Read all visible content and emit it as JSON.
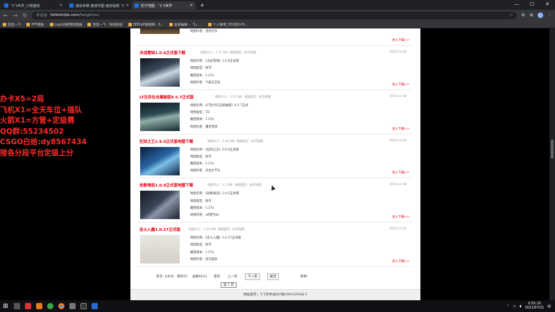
{
  "browser": {
    "tabs": [
      {
        "label": "飞飞世界_只做魔兽",
        "active": false
      },
      {
        "label": "魔兽争霸 魔兽地图 魔兽秘籍 飞",
        "active": false
      },
      {
        "label": "防守地图 - 飞飞世界",
        "active": true
      }
    ],
    "newtab": "+",
    "window_controls": [
      "—",
      "☐",
      "✕"
    ],
    "nav": {
      "back": "←",
      "forward": "→",
      "reload": "↻"
    },
    "address": {
      "security": "不安全",
      "host": "feifeishijie.com",
      "path": "/fangshou/"
    },
    "bookmarks": [
      "百度一下",
      "PPT模板",
      "csgo比赛预测直播",
      "百度一下，你就知道",
      "SEPLAY模组网 - S...",
      "吾爱破解 - 「L」...",
      "个人微博_SEO提升平..."
    ]
  },
  "overlay": {
    "lines": [
      "办卡X5=2局",
      "飞机X1=全天车位+插队",
      "火箭X1=方管+定级赛",
      "QQ群:55234502",
      "CSGO白给:dy8567434",
      "接各分段平台定级上分"
    ]
  },
  "listing": {
    "labels": {
      "name": "地图名称：",
      "type": "地图类型：",
      "env": "魔兽版本：",
      "author": "地图作者：",
      "size_prefix": "地图大小：",
      "type_prefix": "地图类型：",
      "more": "进入下载>>"
    },
    "first_partial": {
      "author": "金铭才乐",
      "more": "进入下载>>"
    },
    "items": [
      {
        "title": "决战雪域1.0.6正式版下载",
        "size": "3.71 MB",
        "category": "防守地图",
        "date": "2019-12-08",
        "name": "《决战雪域》1.0.6正式版",
        "type": "防守",
        "env": "1.27a",
        "author": "气质王先生"
      },
      {
        "title": "LT生存在击离破版9.5.7正式版",
        "size": "2.07 MB",
        "category": "防守地图",
        "date": "2019-12-08",
        "name": "《LT生存在击离破版》9.5.7正式",
        "type": "TD",
        "env": "1.27a",
        "author": "董老师游"
      },
      {
        "title": "狂狱之王2.9.0正式版地图下载",
        "size": "5.06 MB",
        "category": "防守地图",
        "date": "2019-12-08",
        "name": "《狂狱之王》2.9.0正式版",
        "type": "防守",
        "env": "1.27a",
        "author": "武往大学头"
      },
      {
        "title": "劫数难逃1.0.0正式版地图下载",
        "size": "3.5 MB",
        "category": "防守地图",
        "date": "2019-12-08",
        "name": "《劫数难逃》1.0.0正式版",
        "type": "防守",
        "env": "1.27a",
        "author": "o8警告8o"
      },
      {
        "title": "走火入魔1.0.27正式版",
        "size": "5.43 MB",
        "category": "防守地图",
        "date": "2019-12-05",
        "name": "《走火入魔》1.0.27正式版",
        "type": "防守",
        "env": "1.27a",
        "author": "逆天猫命"
      }
    ]
  },
  "pager": {
    "info": "页次: 1/610",
    "per_page": "每页15",
    "total": "总数9143",
    "first": "首页",
    "prev": "上一页",
    "next": "下一页",
    "last": "尾页",
    "goto": "转到:",
    "select": "第 1 页"
  },
  "footer": "网站首页 | 飞飞世界|皖ICP备19014294号-1",
  "taskbar": {
    "time": "0:55:10",
    "date": "2021/07/21"
  }
}
